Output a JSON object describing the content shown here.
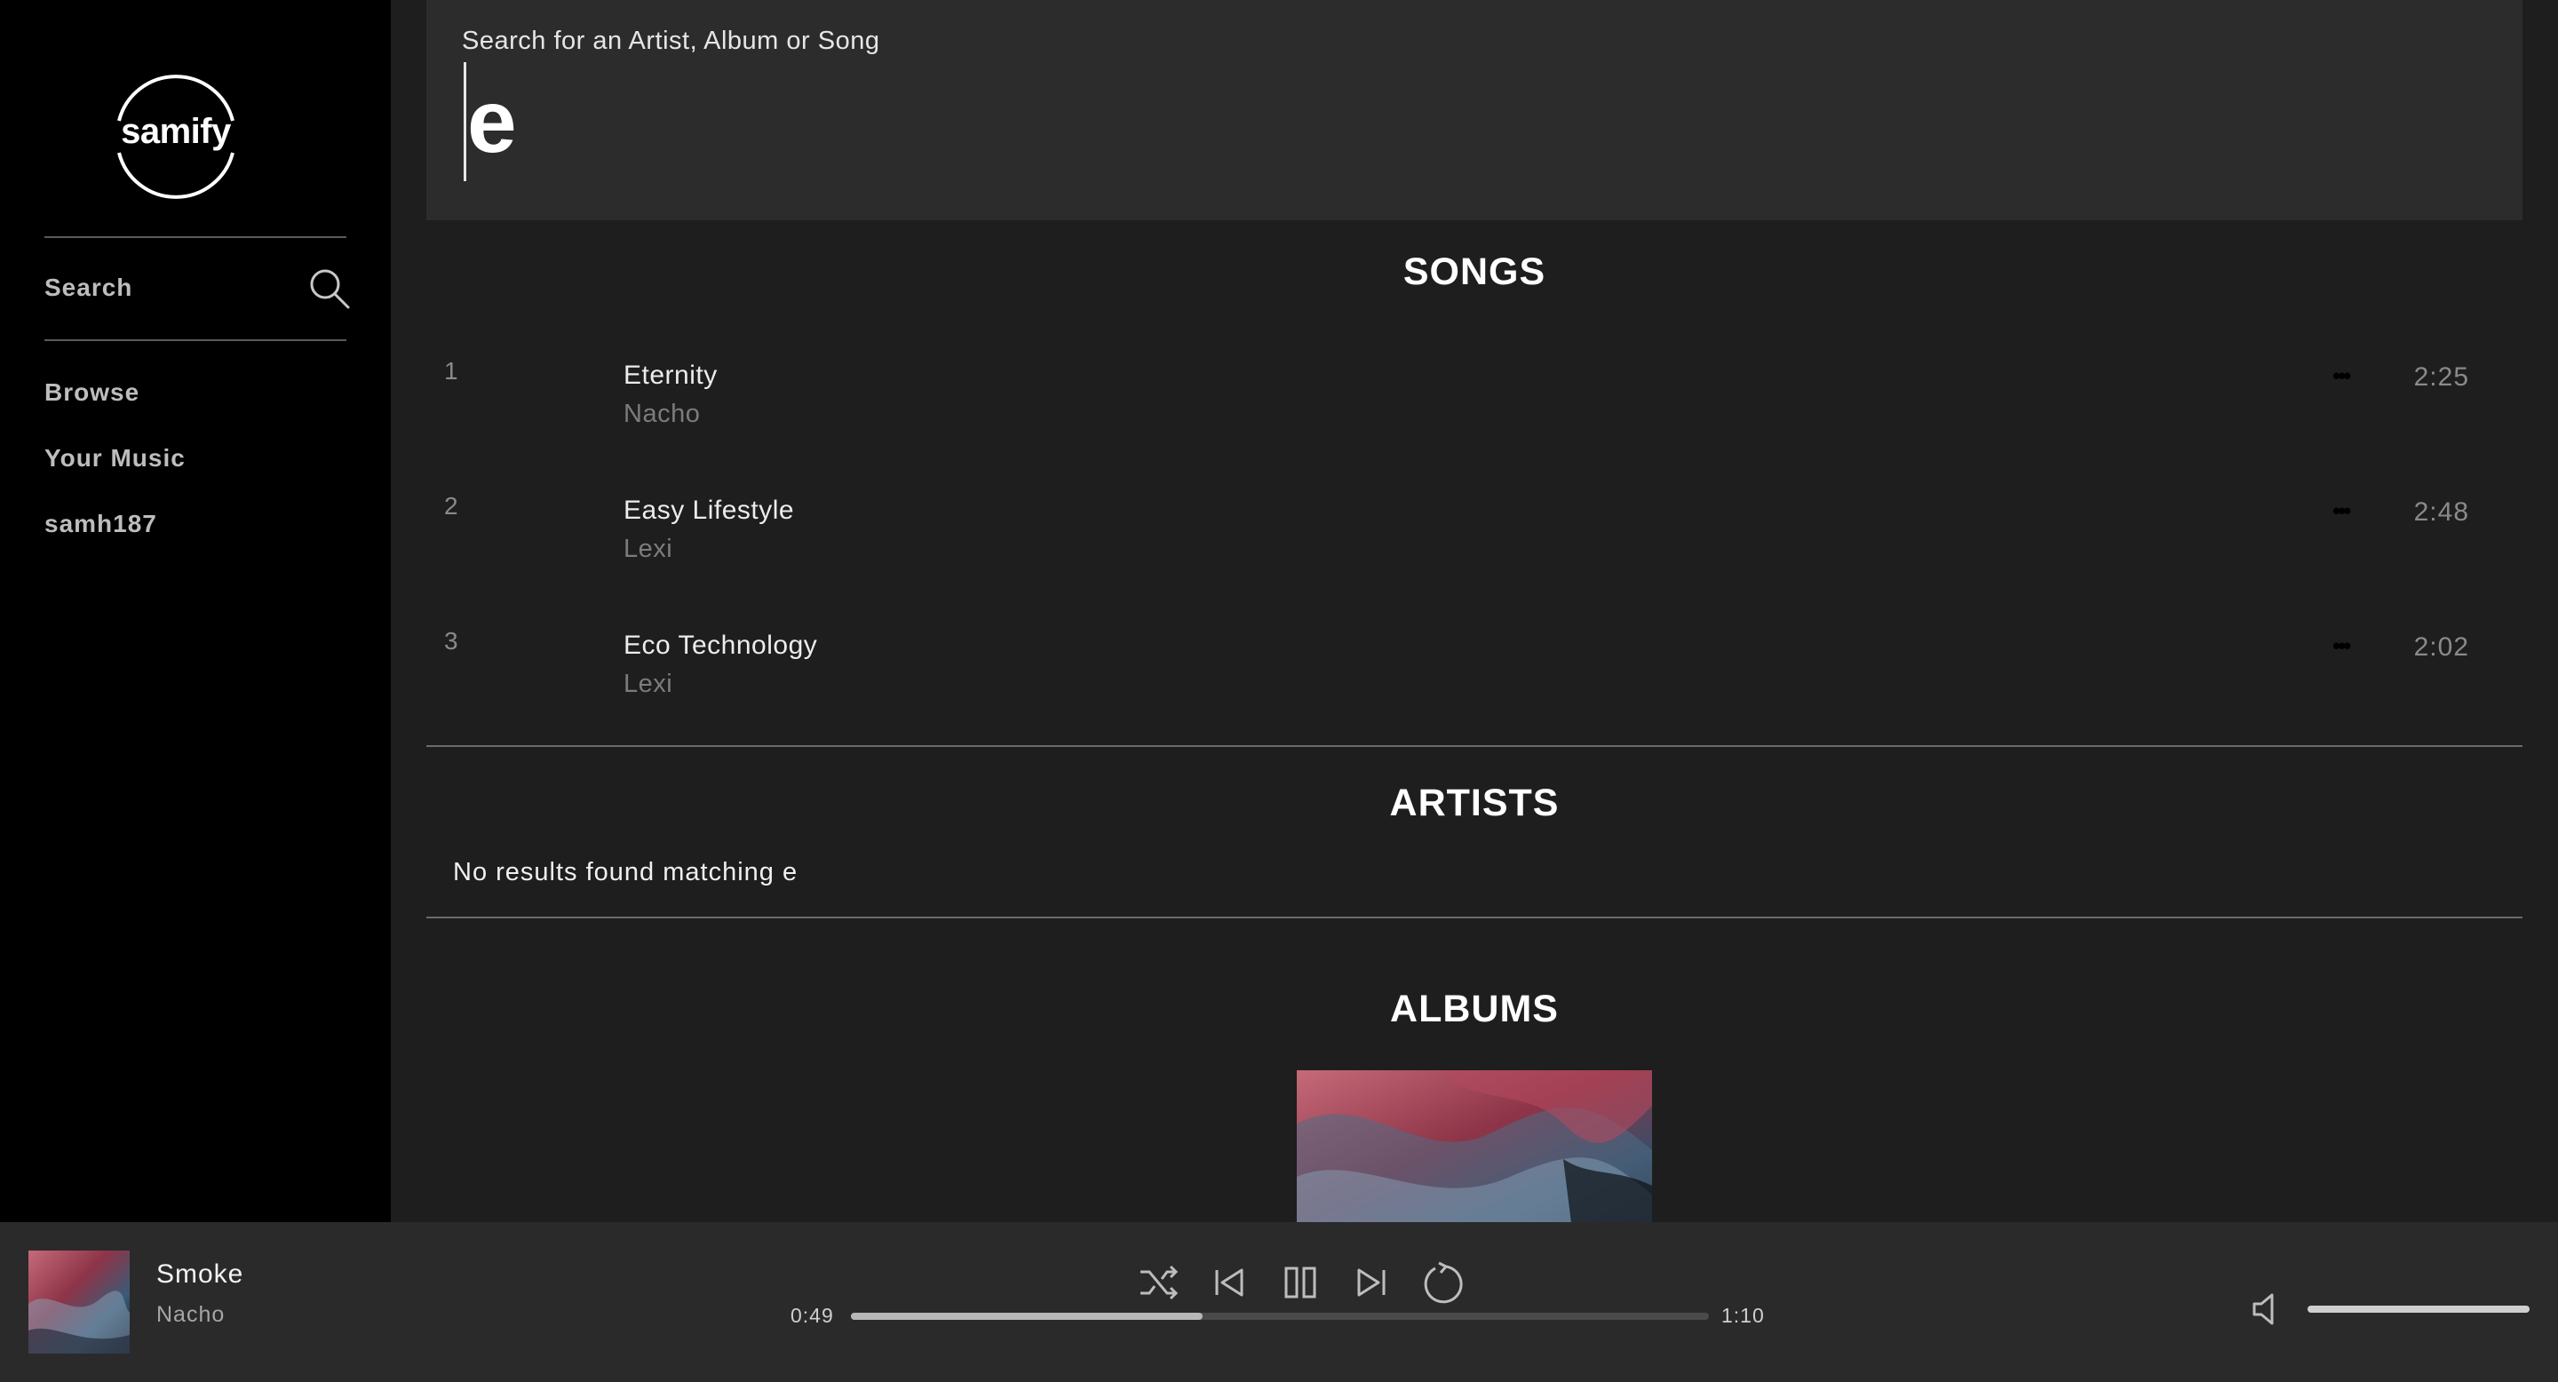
{
  "sidebar": {
    "logo_text": "samify",
    "search_label": "Search",
    "nav": [
      {
        "label": "Browse"
      },
      {
        "label": "Your Music"
      },
      {
        "label": "samh187"
      }
    ]
  },
  "search": {
    "placeholder": "Search for an Artist, Album or Song",
    "value": "e"
  },
  "sections": {
    "songs_title": "SONGS",
    "artists_title": "ARTISTS",
    "albums_title": "ALBUMS",
    "artists_empty": "No results found matching e"
  },
  "songs": [
    {
      "number": "1",
      "title": "Eternity",
      "artist": "Nacho",
      "more": "•••",
      "duration": "2:25"
    },
    {
      "number": "2",
      "title": "Easy Lifestyle",
      "artist": "Lexi",
      "more": "•••",
      "duration": "2:48"
    },
    {
      "number": "3",
      "title": "Eco Technology",
      "artist": "Lexi",
      "more": "•••",
      "duration": "2:02"
    }
  ],
  "player": {
    "track_title": "Smoke",
    "track_artist": "Nacho",
    "elapsed": "0:49",
    "total": "1:10",
    "progress_fraction": 0.41,
    "volume_fraction": 1.0,
    "icons": [
      "shuffle-icon",
      "previous-icon",
      "pause-icon",
      "next-icon",
      "repeat-icon",
      "volume-muted-icon"
    ]
  },
  "colors": {
    "sidebar_bg": "#000000",
    "main_bg": "#1e1e1e",
    "search_bg": "#2c2c2c",
    "player_bg": "#2a2a2a",
    "muted_text": "#8a8a8a"
  }
}
